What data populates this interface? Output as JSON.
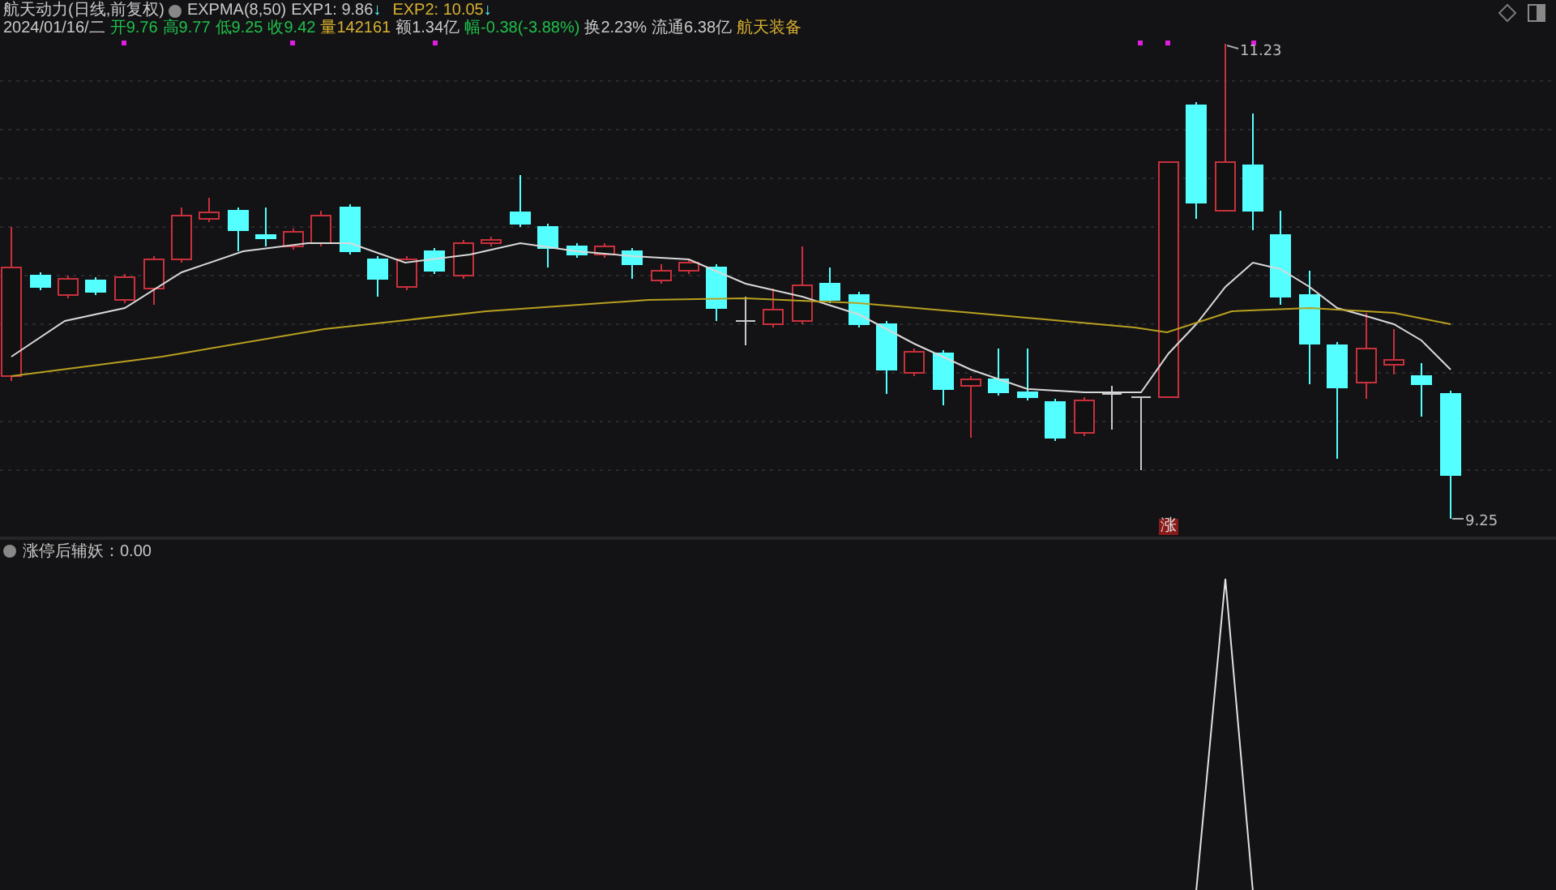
{
  "header": {
    "title": "航天动力(日线,前复权)",
    "indicator": "EXPMA(8,50)",
    "lines": [
      {
        "text": "EXP1: 9.86",
        "arrow": "↓",
        "kind": "fast"
      },
      {
        "text": "EXP2: 10.05",
        "arrow": "↓",
        "kind": "slow"
      }
    ]
  },
  "quote": [
    {
      "text": "2024/01/16/二",
      "kind": "plain"
    },
    {
      "text": "开9.76",
      "kind": "down"
    },
    {
      "text": "高9.77",
      "kind": "down"
    },
    {
      "text": "低9.25",
      "kind": "down"
    },
    {
      "text": "收9.42",
      "kind": "down"
    },
    {
      "text": "量142161",
      "kind": "volume"
    },
    {
      "text": "额1.34亿",
      "kind": "plain"
    },
    {
      "text": "幅-0.38(-3.88%)",
      "kind": "down"
    },
    {
      "text": "换2.23%",
      "kind": "plain"
    },
    {
      "text": "流通6.38亿",
      "kind": "plain"
    },
    {
      "text": "航天装备",
      "kind": "sector"
    }
  ],
  "price_labels": {
    "high": "11.23",
    "low": "9.25"
  },
  "limit_badge": "涨",
  "lower_panel": {
    "label": "涨停后辅妖：0.00"
  }
}
